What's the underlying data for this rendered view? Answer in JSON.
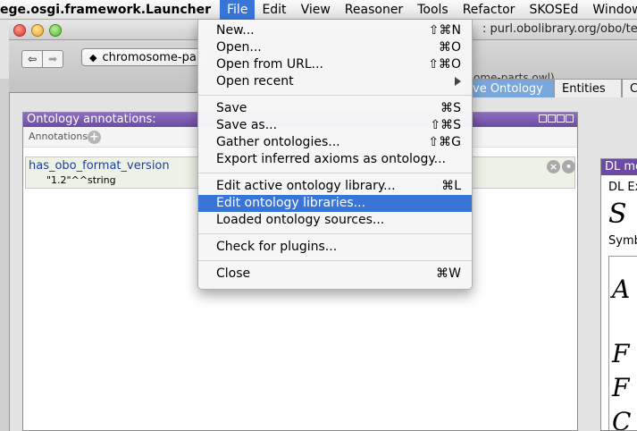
{
  "menubar": {
    "app_name": "ege.osgi.framework.Launcher",
    "items": [
      "File",
      "Edit",
      "View",
      "Reasoner",
      "Tools",
      "Refactor",
      "SKOSEd",
      "Window"
    ]
  },
  "window": {
    "title_fragment": ": purl.obolibrary.org/obo/tes",
    "ontology_combo": "chromosome-pa",
    "iri_fragment": "ome-parts.owl)"
  },
  "tabs": [
    "ve Ontology",
    "Entities",
    "Cla"
  ],
  "file_menu": {
    "groups": [
      [
        {
          "label": "New...",
          "shortcut": "⇧⌘N"
        },
        {
          "label": "Open...",
          "shortcut": "⌘O"
        },
        {
          "label": "Open from URL...",
          "shortcut": "⇧⌘O"
        },
        {
          "label": "Open recent",
          "submenu": true
        }
      ],
      [
        {
          "label": "Save",
          "shortcut": "⌘S"
        },
        {
          "label": "Save as...",
          "shortcut": "⇧⌘S"
        },
        {
          "label": "Gather ontologies...",
          "shortcut": "⇧⌘G"
        },
        {
          "label": "Export inferred axioms as ontology..."
        }
      ],
      [
        {
          "label": "Edit active ontology library...",
          "shortcut": "⌘L"
        },
        {
          "label": "Edit ontology libraries...",
          "highlighted": true
        },
        {
          "label": "Loaded ontology sources..."
        }
      ],
      [
        {
          "label": "Check for plugins..."
        }
      ],
      [
        {
          "label": "Close",
          "shortcut": "⌘W"
        }
      ]
    ]
  },
  "annotations_panel": {
    "header": "Ontology annotations:",
    "label": "Annotations",
    "entry": {
      "property": "has_obo_format_version",
      "value": "\"1.2\"^^string"
    }
  },
  "dl_panel": {
    "header": "DL me",
    "expressivity_label": "DL Ex",
    "expressivity_symbol": "S",
    "symbols_label": "Symb",
    "glyphs": [
      "A",
      "F",
      "F",
      "C"
    ]
  },
  "accent_colors": {
    "menu_highlight": "#3875d7",
    "panel_header": "#6c4ba3",
    "annotation_property": "#1d3f99"
  }
}
